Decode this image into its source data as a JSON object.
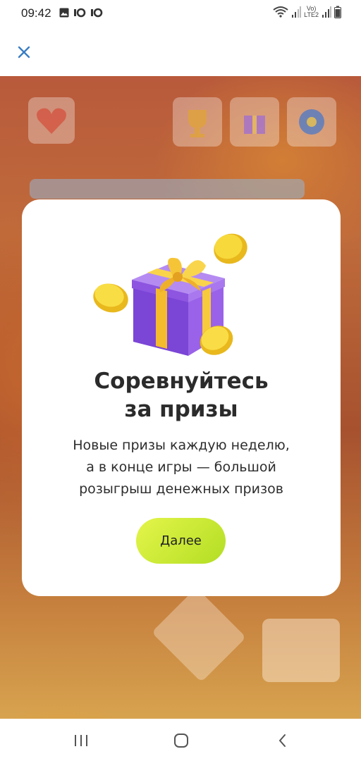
{
  "status_bar": {
    "time": "09:42",
    "left_icons": [
      "image-icon",
      "app-notification-icon",
      "app-notification-icon"
    ],
    "right_icons": [
      "wifi-icon",
      "signal-icon",
      "volte-lte2-icon",
      "signal-icon",
      "battery-icon"
    ],
    "network_label_top": "Vo)",
    "network_label_bottom": "LTE2"
  },
  "top_bar": {
    "close_icon": "close-icon",
    "accent_color": "#3a7ec4"
  },
  "modal": {
    "title": "Соревнуйтесь\nза призы",
    "description": "Новые призы каждую неделю,\nа в конце игры — большой\nрозыгрыш денежных призов",
    "next_button_label": "Далее",
    "button_color": "#c8ea34",
    "illustration_icon": "gift-with-coins-icon"
  },
  "nav_bar": {
    "items": [
      "recent-apps-icon",
      "home-icon",
      "back-icon"
    ]
  }
}
